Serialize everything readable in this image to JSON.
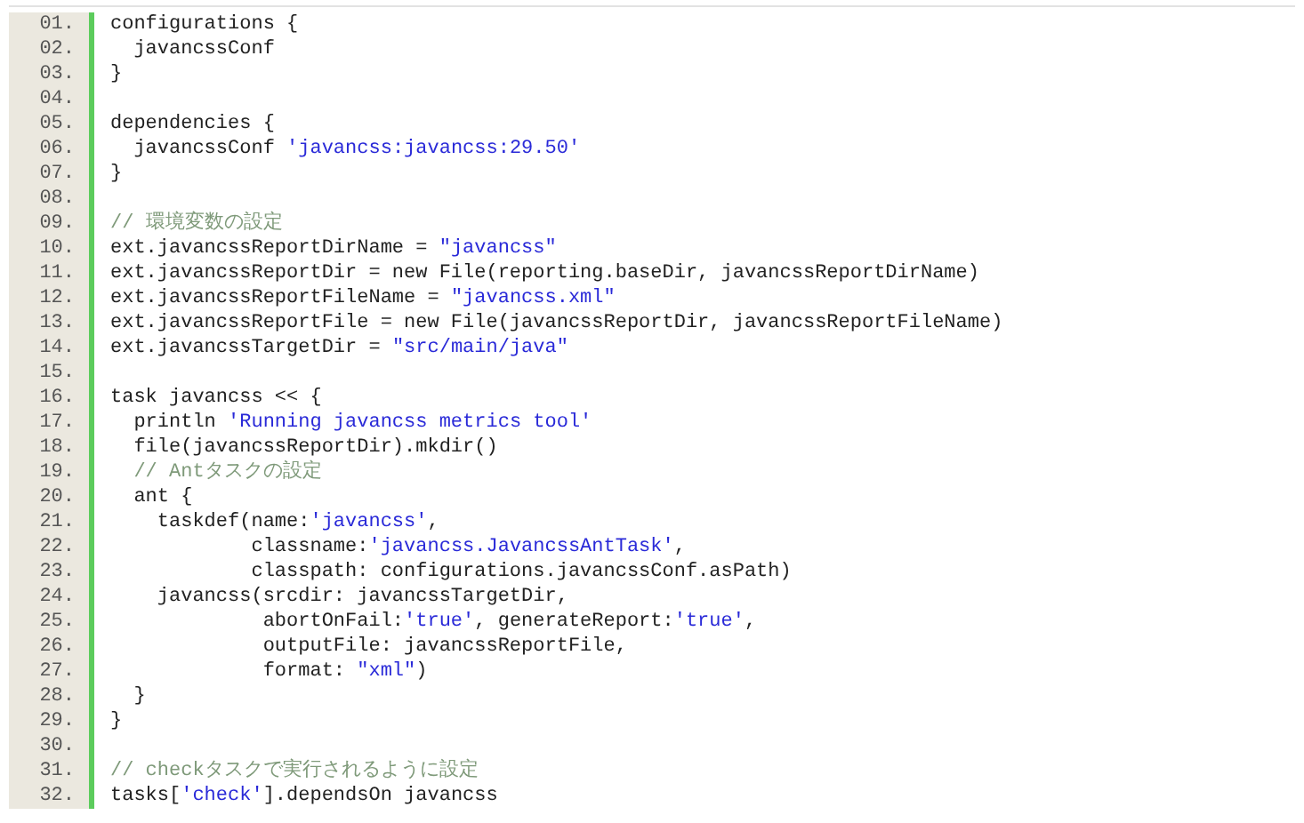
{
  "code_listing": {
    "lines": [
      {
        "number": "01.",
        "segments": [
          {
            "kind": "plain",
            "text": "configurations {"
          }
        ]
      },
      {
        "number": "02.",
        "segments": [
          {
            "kind": "plain",
            "text": "  javancssConf"
          }
        ]
      },
      {
        "number": "03.",
        "segments": [
          {
            "kind": "plain",
            "text": "}"
          }
        ]
      },
      {
        "number": "04."
      },
      {
        "number": "05.",
        "segments": [
          {
            "kind": "plain",
            "text": "dependencies {"
          }
        ]
      },
      {
        "number": "06.",
        "segments": [
          {
            "kind": "plain",
            "text": "  javancssConf "
          },
          {
            "kind": "string",
            "text": "'javancss:javancss:29.50'"
          }
        ]
      },
      {
        "number": "07.",
        "segments": [
          {
            "kind": "plain",
            "text": "}"
          }
        ]
      },
      {
        "number": "08."
      },
      {
        "number": "09.",
        "segments": [
          {
            "kind": "comment",
            "text": "// 環境変数の設定"
          }
        ]
      },
      {
        "number": "10.",
        "segments": [
          {
            "kind": "plain",
            "text": "ext.javancssReportDirName = "
          },
          {
            "kind": "string",
            "text": "\"javancss\""
          }
        ]
      },
      {
        "number": "11.",
        "segments": [
          {
            "kind": "plain",
            "text": "ext.javancssReportDir = new File(reporting.baseDir, javancssReportDirName)"
          }
        ]
      },
      {
        "number": "12.",
        "segments": [
          {
            "kind": "plain",
            "text": "ext.javancssReportFileName = "
          },
          {
            "kind": "string",
            "text": "\"javancss.xml\""
          }
        ]
      },
      {
        "number": "13.",
        "segments": [
          {
            "kind": "plain",
            "text": "ext.javancssReportFile = new File(javancssReportDir, javancssReportFileName)"
          }
        ]
      },
      {
        "number": "14.",
        "segments": [
          {
            "kind": "plain",
            "text": "ext.javancssTargetDir = "
          },
          {
            "kind": "string",
            "text": "\"src/main/java\""
          }
        ]
      },
      {
        "number": "15."
      },
      {
        "number": "16.",
        "segments": [
          {
            "kind": "plain",
            "text": "task javancss << {"
          }
        ]
      },
      {
        "number": "17.",
        "segments": [
          {
            "kind": "plain",
            "text": "  println "
          },
          {
            "kind": "string",
            "text": "'Running javancss metrics tool'"
          }
        ]
      },
      {
        "number": "18.",
        "segments": [
          {
            "kind": "plain",
            "text": "  file(javancssReportDir).mkdir()"
          }
        ]
      },
      {
        "number": "19.",
        "segments": [
          {
            "kind": "comment",
            "text": "  // Antタスクの設定"
          }
        ]
      },
      {
        "number": "20.",
        "segments": [
          {
            "kind": "plain",
            "text": "  ant {"
          }
        ]
      },
      {
        "number": "21.",
        "segments": [
          {
            "kind": "plain",
            "text": "    taskdef(name:"
          },
          {
            "kind": "string",
            "text": "'javancss'"
          },
          {
            "kind": "plain",
            "text": ","
          }
        ]
      },
      {
        "number": "22.",
        "segments": [
          {
            "kind": "plain",
            "text": "            classname:"
          },
          {
            "kind": "string",
            "text": "'javancss.JavancssAntTask'"
          },
          {
            "kind": "plain",
            "text": ","
          }
        ]
      },
      {
        "number": "23.",
        "segments": [
          {
            "kind": "plain",
            "text": "            classpath: configurations.javancssConf.asPath)"
          }
        ]
      },
      {
        "number": "24.",
        "segments": [
          {
            "kind": "plain",
            "text": "    javancss(srcdir: javancssTargetDir,"
          }
        ]
      },
      {
        "number": "25.",
        "segments": [
          {
            "kind": "plain",
            "text": "             abortOnFail:"
          },
          {
            "kind": "string",
            "text": "'true'"
          },
          {
            "kind": "plain",
            "text": ", generateReport:"
          },
          {
            "kind": "string",
            "text": "'true'"
          },
          {
            "kind": "plain",
            "text": ","
          }
        ]
      },
      {
        "number": "26.",
        "segments": [
          {
            "kind": "plain",
            "text": "             outputFile: javancssReportFile,"
          }
        ]
      },
      {
        "number": "27.",
        "segments": [
          {
            "kind": "plain",
            "text": "             format: "
          },
          {
            "kind": "string",
            "text": "\"xml\""
          },
          {
            "kind": "plain",
            "text": ")"
          }
        ]
      },
      {
        "number": "28.",
        "segments": [
          {
            "kind": "plain",
            "text": "  }"
          }
        ]
      },
      {
        "number": "29.",
        "segments": [
          {
            "kind": "plain",
            "text": "}"
          }
        ]
      },
      {
        "number": "30."
      },
      {
        "number": "31.",
        "segments": [
          {
            "kind": "comment",
            "text": "// checkタスクで実行されるように設定"
          }
        ]
      },
      {
        "number": "32.",
        "segments": [
          {
            "kind": "plain",
            "text": "tasks["
          },
          {
            "kind": "string",
            "text": "'check'"
          },
          {
            "kind": "plain",
            "text": "].dependsOn javancss"
          }
        ]
      }
    ]
  }
}
